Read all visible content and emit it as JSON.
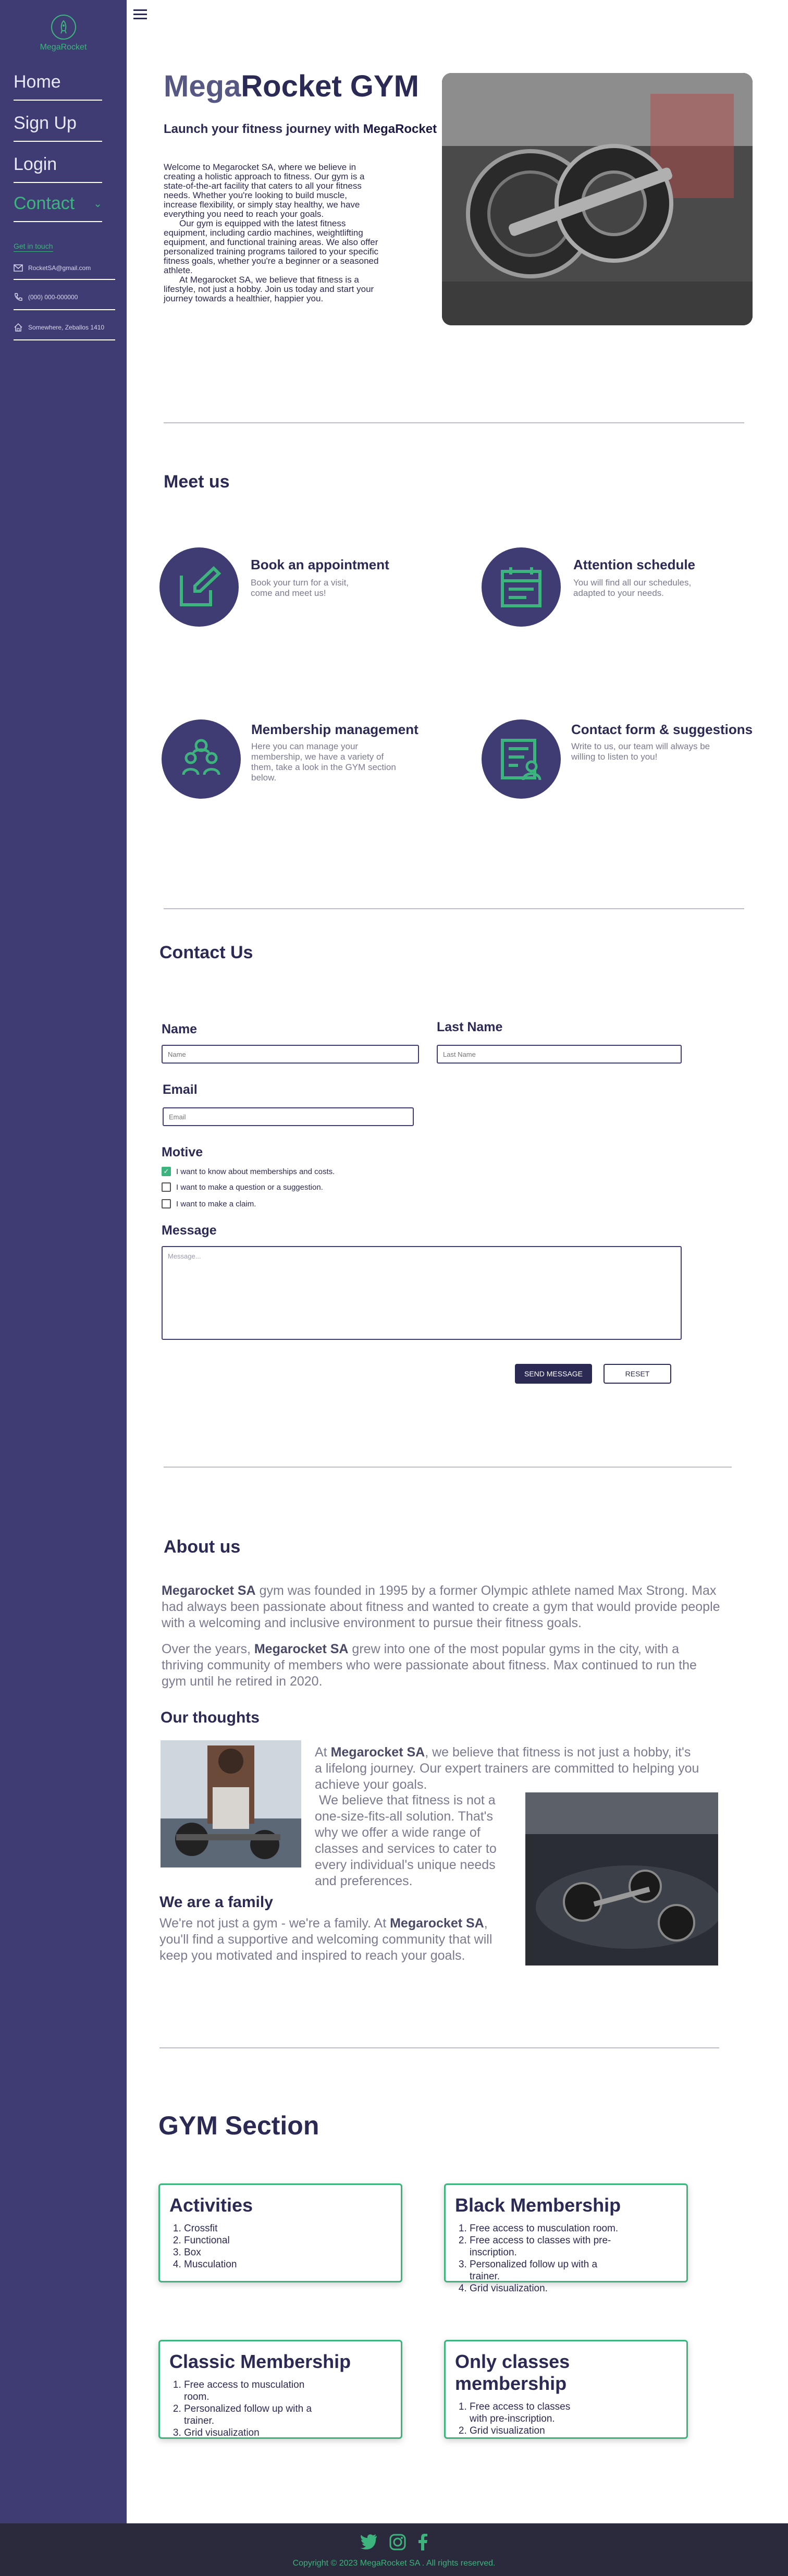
{
  "sidebar": {
    "logo": "MegaRocket",
    "nav": [
      "Home",
      "Sign Up",
      "Login"
    ],
    "contact": "Contact",
    "get_in_touch": "Get in touch",
    "email": "RocketSA@gmail.com",
    "phone": "(000) 000-000000",
    "address": "Somewhere, Zeballos 1410"
  },
  "hero": {
    "title_part1": "Mega",
    "title_part2": "Rocket GYM",
    "subtitle_prefix": "Launch your fitness journey with ",
    "subtitle_brand": "MegaRocket",
    "paragraphs": [
      "Welcome to Megarocket SA, where we believe in creating a holistic approach to fitness. Our gym is a state-of-the-art facility that caters to all your fitness needs. Whether you're looking to build muscle, increase flexibility, or simply stay healthy, we have everything you need to reach your goals.",
      "Our gym is equipped with the latest fitness equipment, including cardio machines, weightlifting equipment, and functional training areas. We also offer personalized training programs tailored to your specific fitness goals, whether you're a beginner or a seasoned athlete.",
      "At Megarocket SA, we believe that fitness is a lifestyle, not just a hobby. Join us today and start your journey towards a healthier, happier you."
    ]
  },
  "meet": {
    "title": "Meet us",
    "features": [
      {
        "title": "Book an appointment",
        "desc": "Book your turn for a visit, come and meet us!",
        "icon": "edit-icon"
      },
      {
        "title": "Attention schedule",
        "desc": "You will find all our schedules, adapted to your needs.",
        "icon": "calendar-icon"
      },
      {
        "title": "Membership management",
        "desc": "Here you can manage your membership, we have a variety of them, take a look in the GYM section below.",
        "icon": "group-icon"
      },
      {
        "title": "Contact form & suggestions",
        "desc": "Write to us, our team will always be willing to listen to you!",
        "icon": "form-icon"
      }
    ]
  },
  "contact": {
    "title": "Contact Us",
    "name_label": "Name",
    "name_placeholder": "Name",
    "last_label": "Last Name",
    "last_placeholder": "Last Name",
    "email_label": "Email",
    "email_placeholder": "Email",
    "motive_label": "Motive",
    "motives": [
      {
        "label": "I want to know about memberships and costs.",
        "checked": true
      },
      {
        "label": "I want to make a question or a suggestion.",
        "checked": false
      },
      {
        "label": "I want to make a claim.",
        "checked": false
      }
    ],
    "message_label": "Message",
    "message_placeholder": "Message...",
    "send": "SEND MESSAGE",
    "reset": "RESET"
  },
  "about": {
    "title": "About us",
    "p1_brand": "Megarocket SA",
    "p1_rest": " gym was founded in 1995 by a former Olympic athlete named Max Strong. Max had always been passionate about fitness and wanted to create a gym that would provide people with a welcoming and inclusive environment to pursue their fitness goals.",
    "p2_start": "Over the years, ",
    "p2_brand": "Megarocket SA",
    "p2_rest": " grew into one of the most popular gyms in the city, with a thriving community of members who were passionate about fitness. Max continued to run the gym until he retired in 2020.",
    "thoughts_title": "Our thoughts",
    "t1_start": "At ",
    "t1_brand": "Megarocket SA",
    "t1_rest": ", we believe that fitness is not just a hobby, it's a lifelong journey. Our expert trainers are committed to helping you achieve your goals.",
    "t2": "We believe that fitness is not a one-size-fits-all solution. That's why we offer a wide range of classes and services to cater to every individual's unique needs and preferences.",
    "family_title": "We are a family",
    "f_start": "We're not just a gym - we're a family. At ",
    "f_brand": "Megarocket SA",
    "f_rest": ", you'll find a supportive and welcoming community that will keep you motivated  and inspired to reach your goals."
  },
  "gym": {
    "title": "GYM Section",
    "cards": [
      {
        "title": "Activities",
        "items": [
          "Crossfit",
          "Functional",
          "Box",
          "Musculation"
        ]
      },
      {
        "title": "Black Membership",
        "items": [
          "Free access to musculation room.",
          "Free access to classes with pre-inscription.",
          "Personalized follow up with a trainer.",
          "Grid visualization."
        ]
      },
      {
        "title": "Classic Membership",
        "items": [
          "Free access to musculation room.",
          "Personalized follow up with a trainer.",
          "Grid visualization"
        ]
      },
      {
        "title": "Only classes membership",
        "items": [
          "Free access to classes with pre-inscription.",
          "Grid visualization"
        ]
      }
    ]
  },
  "footer": {
    "copyright": "Copyright © 2023 MegaRocket SA . All rights reserved."
  },
  "colors": {
    "primary": "#3f3c73",
    "accent": "#3db37d",
    "text": "#2b2a55"
  }
}
